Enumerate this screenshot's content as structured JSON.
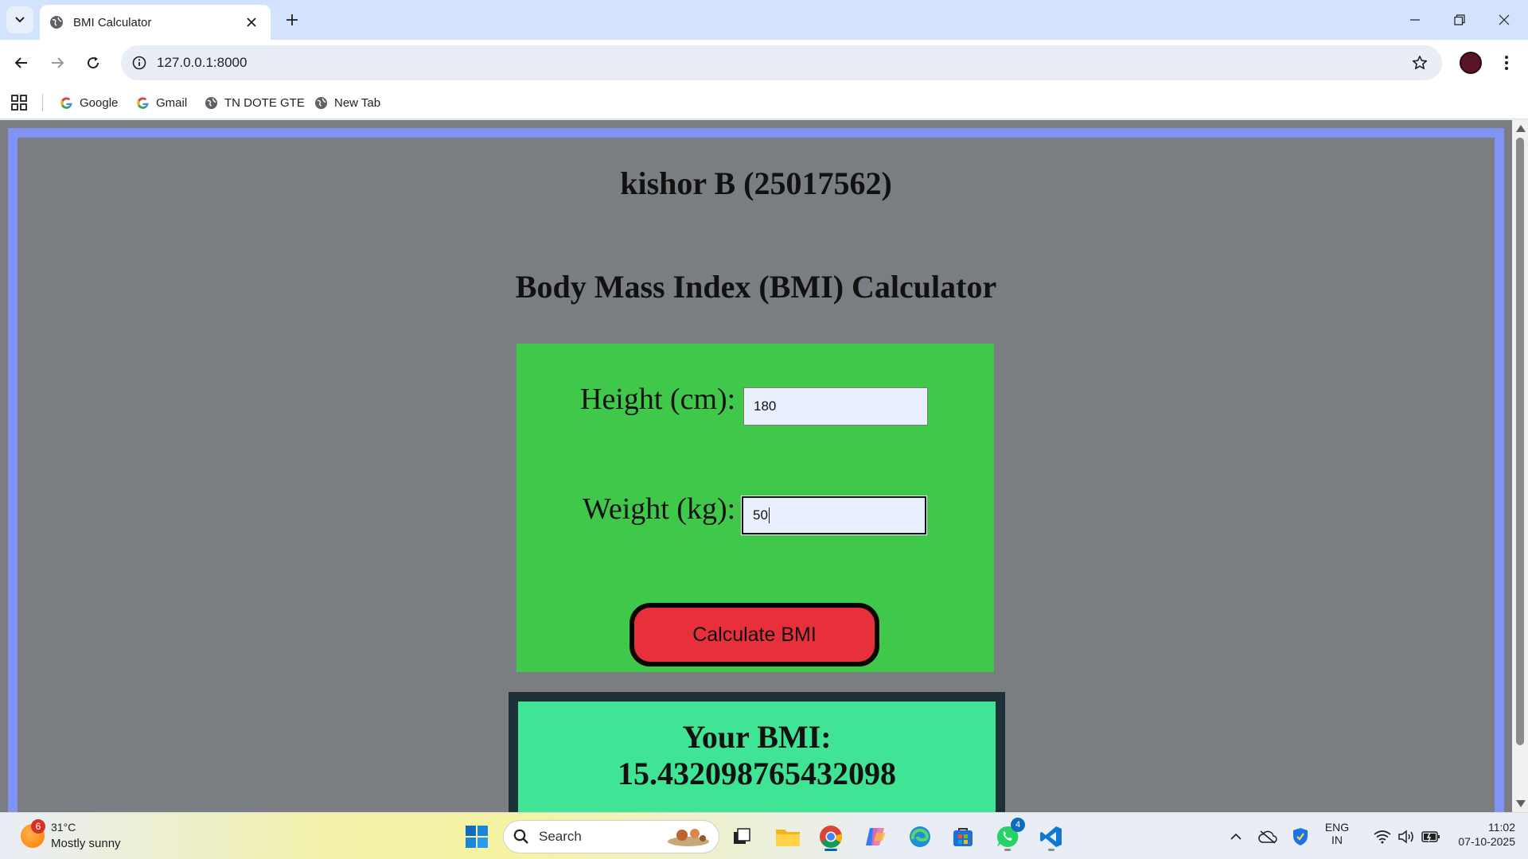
{
  "browser": {
    "tab_title": "BMI Calculator",
    "url": "127.0.0.1:8000",
    "bookmarks": [
      {
        "label": "Google",
        "icon": "google-icon"
      },
      {
        "label": "Gmail",
        "icon": "google-icon"
      },
      {
        "label": "TN DOTE GTE",
        "icon": "globe-icon"
      },
      {
        "label": "New Tab",
        "icon": "globe-icon"
      }
    ]
  },
  "page": {
    "author": "kishor B (25017562)",
    "heading": "Body Mass Index (BMI) Calculator",
    "height_label": "Height (cm):",
    "height_value": "180",
    "weight_label": "Weight (kg):",
    "weight_value": "50",
    "calculate_label": "Calculate BMI",
    "result_label": "Your BMI:",
    "result_value": "15.432098765432098"
  },
  "taskbar": {
    "weather_badge": "6",
    "weather_temp": "31°C",
    "weather_desc": "Mostly sunny",
    "search_label": "Search",
    "whatsapp_badge": "4",
    "lang_top": "ENG",
    "lang_bottom": "IN",
    "time": "11:02",
    "date": "07-10-2025"
  },
  "colors": {
    "page_bg": "#7a7d82",
    "frame_border": "#8193f5",
    "form_bg": "#40c84a",
    "button_bg": "#e8303c",
    "result_bg": "#3fe595",
    "result_border": "#1d3138"
  }
}
